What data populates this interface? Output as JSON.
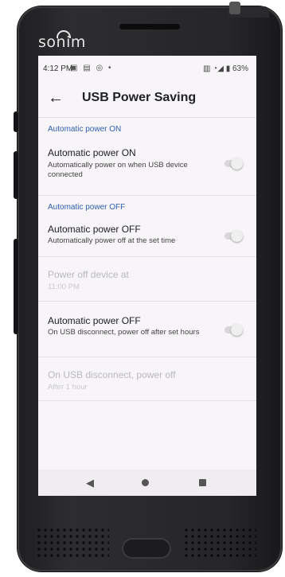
{
  "device": {
    "brand": "sonim"
  },
  "status_bar": {
    "time": "4:12 PM",
    "notification_icons": "▣ ▤ ◎ •",
    "system_icons": "▥ ◔◢",
    "battery": "63%"
  },
  "app_bar": {
    "back_icon": "arrow-left-icon",
    "title": "USB Power Saving"
  },
  "sections": {
    "on": {
      "header": "Automatic power ON",
      "row": {
        "title": "Automatic power ON",
        "subtitle": "Automatically power on when USB device connected",
        "toggle": "off"
      }
    },
    "off": {
      "header": "Automatic power OFF",
      "row1": {
        "title": "Automatic power OFF",
        "subtitle": "Automatically power off at the set time",
        "toggle": "off"
      },
      "row2": {
        "title": "Power off device at",
        "subtitle": "11:00 PM",
        "enabled": false
      },
      "row3": {
        "title": "Automatic power OFF",
        "subtitle": "On USB disconnect, power off after set hours",
        "toggle": "off"
      },
      "row4": {
        "title": "On USB disconnect, power off",
        "subtitle": "After 1 hour",
        "enabled": false
      }
    }
  },
  "nav_bar": {
    "back": "◀",
    "home": "home-circle",
    "recents": "recents-square"
  }
}
